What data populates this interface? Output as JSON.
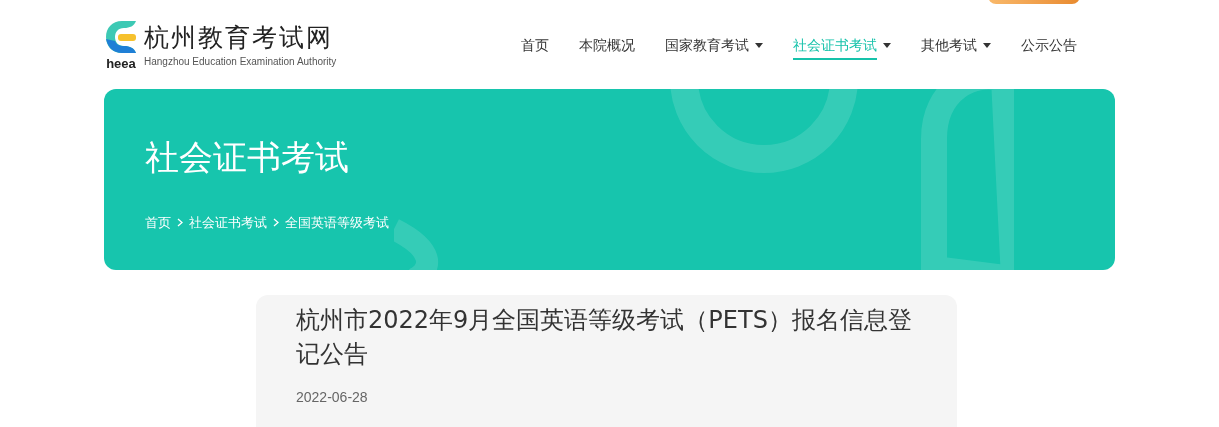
{
  "logo": {
    "title": "杭州教育考试网",
    "abbr": "heea",
    "subtitle": "Hangzhou Education Examination Authority"
  },
  "nav": [
    {
      "label": "首页",
      "selected": false,
      "dropdown": false
    },
    {
      "label": "本院概况",
      "selected": false,
      "dropdown": false
    },
    {
      "label": "国家教育考试",
      "selected": false,
      "dropdown": true
    },
    {
      "label": "社会证书考试",
      "selected": true,
      "dropdown": true
    },
    {
      "label": "其他考试",
      "selected": false,
      "dropdown": true
    },
    {
      "label": "公示公告",
      "selected": false,
      "dropdown": false
    }
  ],
  "banner": {
    "title": "社会证书考试",
    "breadcrumb": [
      "首页",
      "社会证书考试",
      "全国英语等级考试"
    ]
  },
  "article": {
    "title": "杭州市2022年9月全国英语等级考试（PETS）报名信息登记公告",
    "date": "2022-06-28"
  }
}
